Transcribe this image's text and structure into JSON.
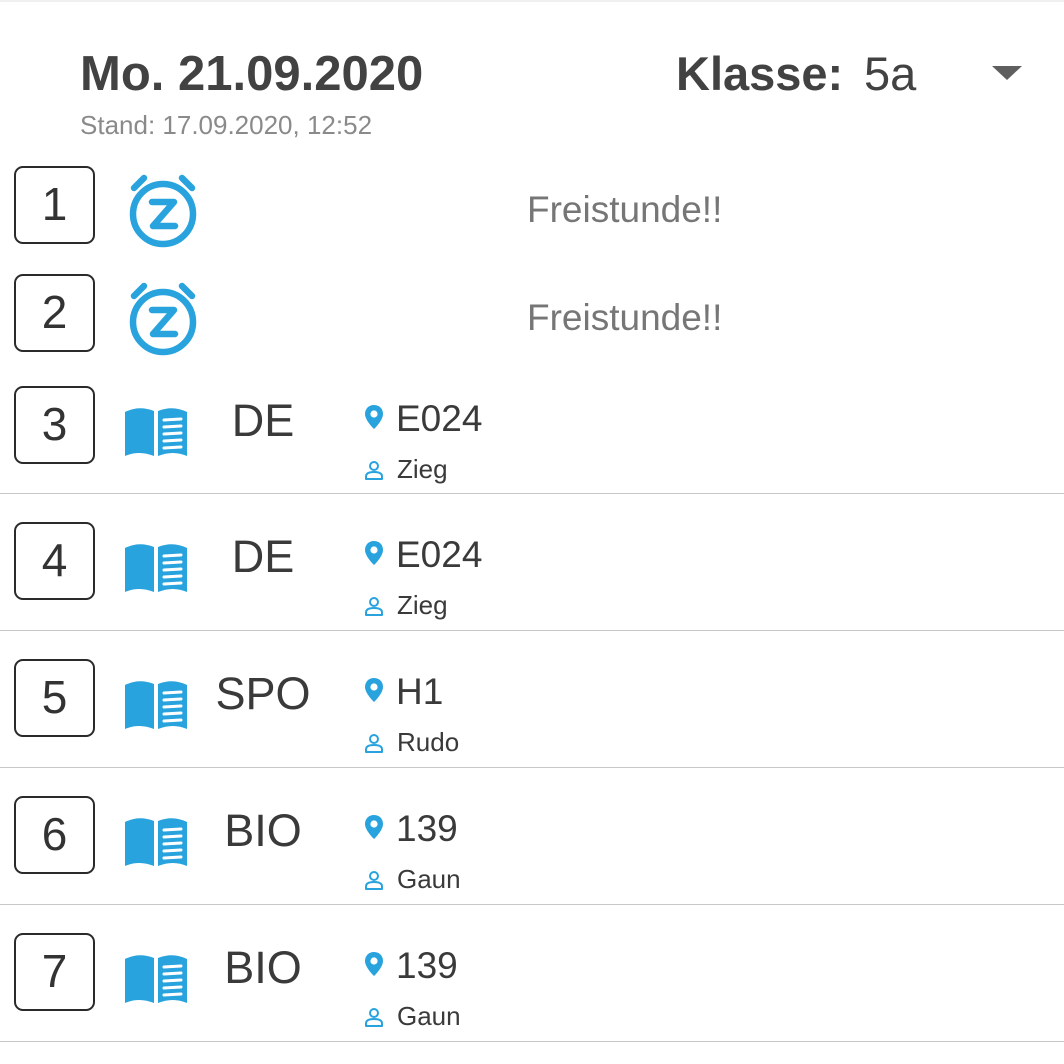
{
  "header": {
    "date": "Mo. 21.09.2020",
    "stand": "Stand: 17.09.2020, 12:52",
    "class_label": "Klasse:",
    "class_value": "5a"
  },
  "colors": {
    "accent": "#29a3dd",
    "text": "#3a3a3a",
    "muted": "#767676",
    "divider": "#c8c8c8"
  },
  "periods": [
    {
      "number": "1",
      "type": "free",
      "icon": "alarm-clock-snooze-icon",
      "text": "Freistunde!!"
    },
    {
      "number": "2",
      "type": "free",
      "icon": "alarm-clock-snooze-icon",
      "text": "Freistunde!!"
    },
    {
      "number": "3",
      "type": "lesson",
      "icon": "open-book-icon",
      "subject": "DE",
      "room": "E024",
      "teacher": "Zieg"
    },
    {
      "number": "4",
      "type": "lesson",
      "icon": "open-book-icon",
      "subject": "DE",
      "room": "E024",
      "teacher": "Zieg"
    },
    {
      "number": "5",
      "type": "lesson",
      "icon": "open-book-icon",
      "subject": "SPO",
      "room": "H1",
      "teacher": "Rudo"
    },
    {
      "number": "6",
      "type": "lesson",
      "icon": "open-book-icon",
      "subject": "BIO",
      "room": "139",
      "teacher": "Gaun"
    },
    {
      "number": "7",
      "type": "lesson",
      "icon": "open-book-icon",
      "subject": "BIO",
      "room": "139",
      "teacher": "Gaun"
    }
  ]
}
